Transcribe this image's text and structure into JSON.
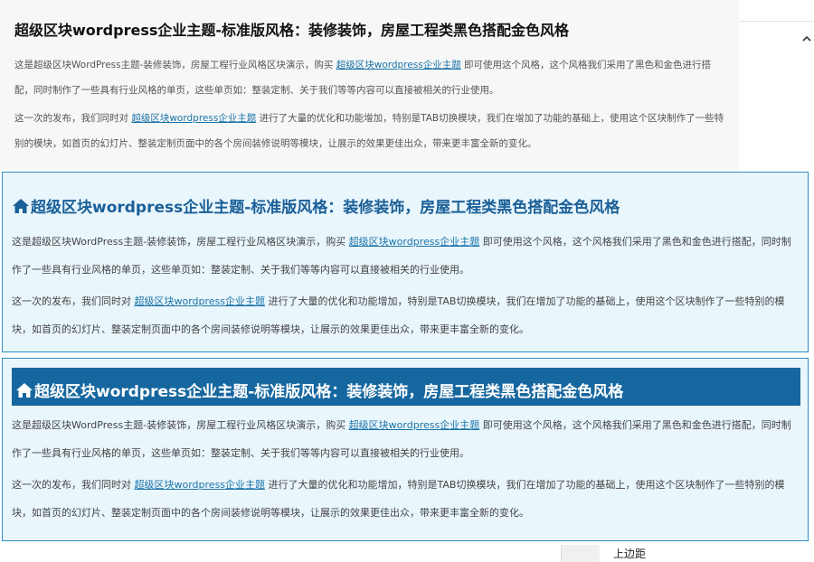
{
  "title": "超级区块wordpress企业主题-标准版风格：装修装饰，房屋工程类黑色搭配金色风格",
  "paragraph1": {
    "before": "这是超级区块WordPress主题-装修装饰，房屋工程行业风格区块演示，购买 ",
    "link": "超级区块wordpress企业主题",
    "after": " 即可使用这个风格，这个风格我们采用了黑色和金色进行搭配，同时制作了一些具有行业风格的单页，这些单页如：整装定制、关于我们等等内容可以直接被相关的行业使用。"
  },
  "paragraph2": {
    "before": "这一次的发布，我们同时对 ",
    "link": "超级区块wordpress企业主题",
    "after": " 进行了大量的优化和功能增加，特别是TAB切换模块，我们在增加了功能的基础上，使用这个区块制作了一些特别的模块，如首页的幻灯片、整装定制页面中的各个房间装修说明等模块，让展示的效果更佳出众，带来更丰富全新的变化。"
  },
  "bottom_label": "上边距",
  "icons": {
    "home": "home-icon",
    "chevron": "chevron-up-icon"
  },
  "colors": {
    "link": "#1a73a8",
    "box_bg": "#e9f6fc",
    "box_border": "#2f8fc2",
    "title_blue": "#1a5f98",
    "title_bar": "#16679f"
  }
}
